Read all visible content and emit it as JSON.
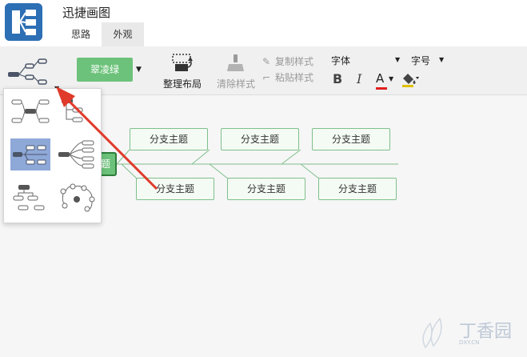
{
  "app": {
    "title": "迅捷画图",
    "accent_color": "#2d6fb4",
    "logo_icon": "mindmap-logo-icon"
  },
  "tabs": [
    {
      "label": "思路",
      "active": false
    },
    {
      "label": "外观",
      "active": true
    }
  ],
  "toolbar": {
    "layout_icon": "layout-structure-icon",
    "theme_label": "翠凌绿",
    "theme_color": "#6cc27a",
    "arrange_label": "整理布局",
    "clear_style_label": "清除样式",
    "copy_style_label": "复制样式",
    "paste_style_label": "粘贴样式",
    "font_family_label": "字体",
    "font_size_label": "字号",
    "bold_label": "B",
    "italic_label": "I",
    "font_color_label": "A",
    "font_color": "#e02020"
  },
  "canvas": {
    "central_node_text": "题",
    "branches": [
      {
        "label": "分支主题"
      },
      {
        "label": "分支主题"
      },
      {
        "label": "分支主题"
      },
      {
        "label": "分支主题"
      },
      {
        "label": "分支主题"
      },
      {
        "label": "分支主题"
      }
    ]
  },
  "layout_dropdown": {
    "options": [
      {
        "name": "mindmap-layout",
        "selected": false
      },
      {
        "name": "org-tree-right-layout",
        "selected": false
      },
      {
        "name": "fishbone-right-layout",
        "selected": true
      },
      {
        "name": "logic-left-layout",
        "selected": false
      },
      {
        "name": "tree-table-layout",
        "selected": false
      },
      {
        "name": "network-layout",
        "selected": false
      }
    ]
  },
  "watermark": {
    "text": "丁香园",
    "sub": "DXY.CN"
  }
}
